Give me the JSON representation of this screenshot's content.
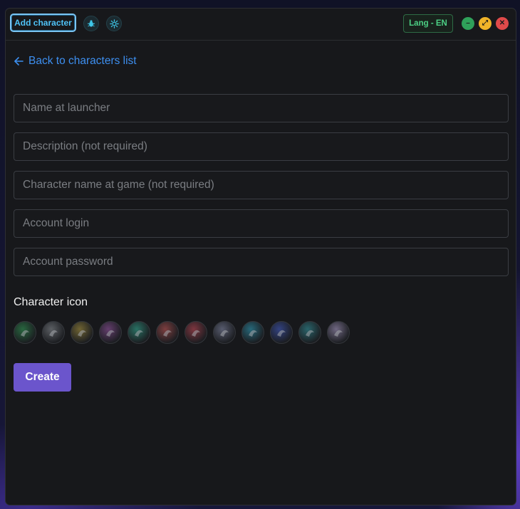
{
  "titlebar": {
    "add_character_label": "Add character",
    "bug_icon": "bug-icon",
    "settings_icon": "gear-icon",
    "lang_label": "Lang - EN",
    "controls": [
      {
        "name": "minimize",
        "glyph": "–",
        "color": "#2fa15a"
      },
      {
        "name": "maximize",
        "glyph": "⤢",
        "color": "#f0b429"
      },
      {
        "name": "close",
        "glyph": "✕",
        "color": "#e04a4a"
      }
    ]
  },
  "form": {
    "back_label": "Back to characters list",
    "fields": [
      {
        "key": "name_at_launcher",
        "placeholder": "Name at launcher",
        "value": ""
      },
      {
        "key": "description",
        "placeholder": "Description (not required)",
        "value": ""
      },
      {
        "key": "character_name",
        "placeholder": "Character name at game (not required)",
        "value": ""
      },
      {
        "key": "account_login",
        "placeholder": "Account login",
        "value": ""
      },
      {
        "key": "account_password",
        "placeholder": "Account password",
        "value": ""
      }
    ],
    "icon_section_label": "Character icon",
    "character_icons": [
      {
        "name": "green-swirl-icon",
        "color": "#2e7d4a"
      },
      {
        "name": "grey-wing-icon",
        "color": "#6f7378"
      },
      {
        "name": "gold-crest-icon",
        "color": "#8a7a3a"
      },
      {
        "name": "violet-mask-icon",
        "color": "#7b4a86"
      },
      {
        "name": "yin-yang-icon",
        "color": "#2f8a78"
      },
      {
        "name": "red-flame-icon",
        "color": "#9a4a4a"
      },
      {
        "name": "red-orb-icon",
        "color": "#9b3f4a"
      },
      {
        "name": "steel-blade-icon",
        "color": "#6a6f86"
      },
      {
        "name": "teal-wave-icon",
        "color": "#2c7f95"
      },
      {
        "name": "blue-storm-icon",
        "color": "#3b4f9e"
      },
      {
        "name": "teal-feather-icon",
        "color": "#2f7a82"
      },
      {
        "name": "silver-moon-icon",
        "color": "#8a7fa0"
      }
    ],
    "create_label": "Create"
  }
}
